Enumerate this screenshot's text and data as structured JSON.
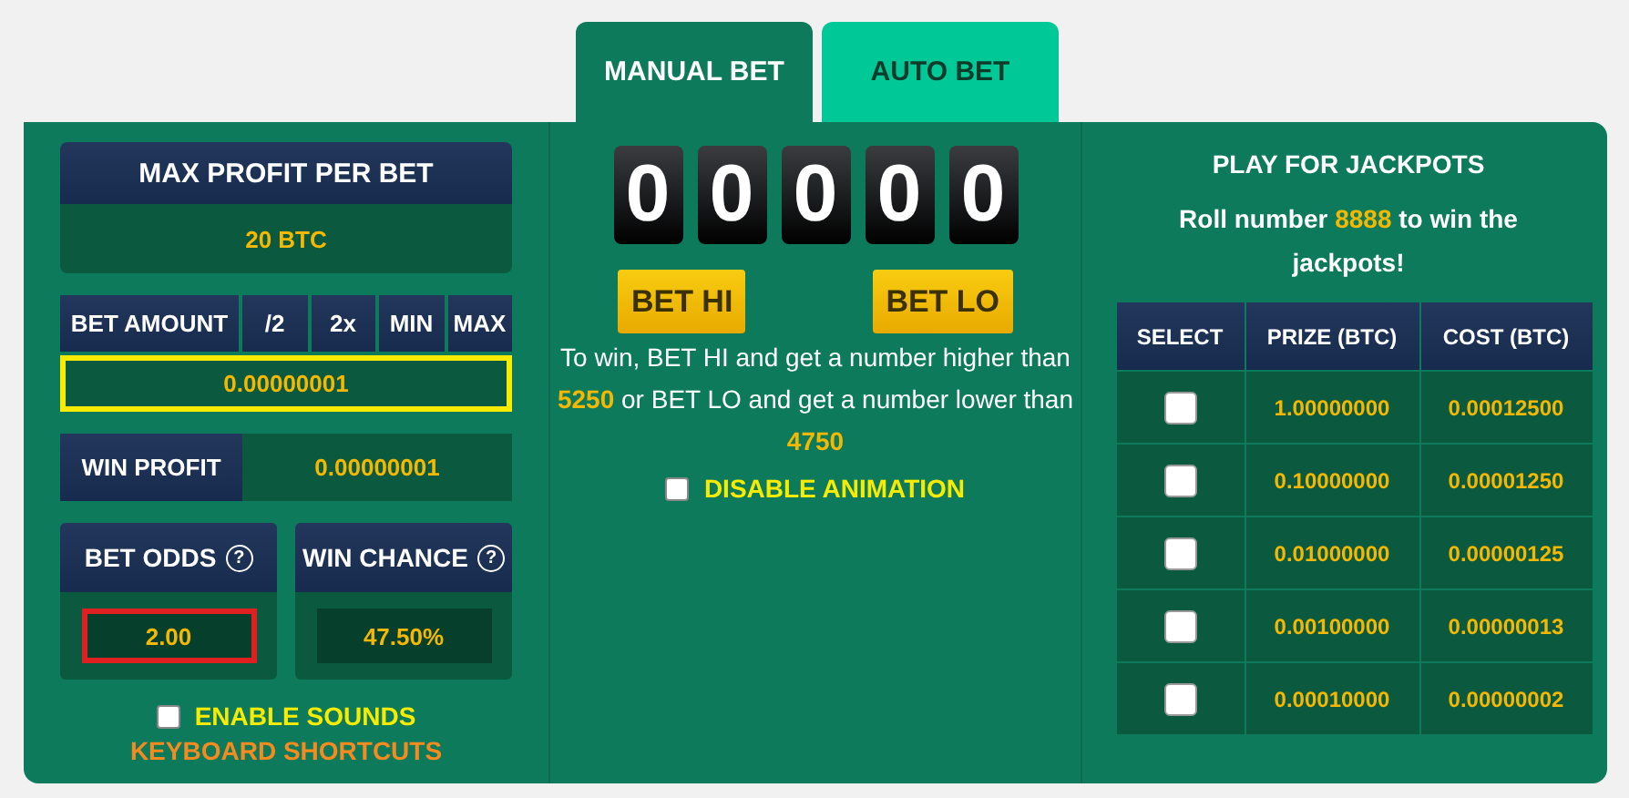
{
  "tabs": [
    {
      "label": "MANUAL BET",
      "selected": true
    },
    {
      "label": "AUTO BET",
      "selected": false
    }
  ],
  "max_profit": {
    "label": "MAX PROFIT PER BET",
    "value": "20 BTC"
  },
  "bet_amount": {
    "label": "BET AMOUNT",
    "buttons": [
      "/2",
      "2x",
      "MIN",
      "MAX"
    ],
    "value": "0.00000001",
    "focused": true
  },
  "win_profit": {
    "label": "WIN PROFIT",
    "value": "0.00000001"
  },
  "bet_odds": {
    "label": "BET ODDS",
    "help": "?",
    "value": "2.00",
    "error": true
  },
  "win_chance": {
    "label": "WIN CHANCE",
    "help": "?",
    "value": "47.50%",
    "error": false
  },
  "enable_sounds": {
    "label": "ENABLE SOUNDS",
    "checked": false
  },
  "keyboard_shortcuts": "KEYBOARD SHORTCUTS",
  "roll_digits": [
    "0",
    "0",
    "0",
    "0",
    "0"
  ],
  "bet_buttons": [
    "BET HI",
    "BET LO"
  ],
  "rule_text": "To win, BET HI and get a number higher than **5250** or BET LO and get a number lower than **4750**",
  "disable_animation": {
    "label": "DISABLE ANIMATION",
    "checked": false
  },
  "jackpots": {
    "title": "PLAY FOR JACKPOTS",
    "note": "Roll number **8888** to win the jackpots!",
    "columns": [
      "SELECT",
      "PRIZE (BTC)",
      "COST (BTC)"
    ],
    "rows": [
      {
        "checked": false,
        "prize": "1.00000000",
        "cost": "0.00012500"
      },
      {
        "checked": false,
        "prize": "0.10000000",
        "cost": "0.00001250"
      },
      {
        "checked": false,
        "prize": "0.01000000",
        "cost": "0.00000125"
      },
      {
        "checked": false,
        "prize": "0.00100000",
        "cost": "0.00000013"
      },
      {
        "checked": false,
        "prize": "0.00010000",
        "cost": "0.00000002"
      }
    ]
  }
}
